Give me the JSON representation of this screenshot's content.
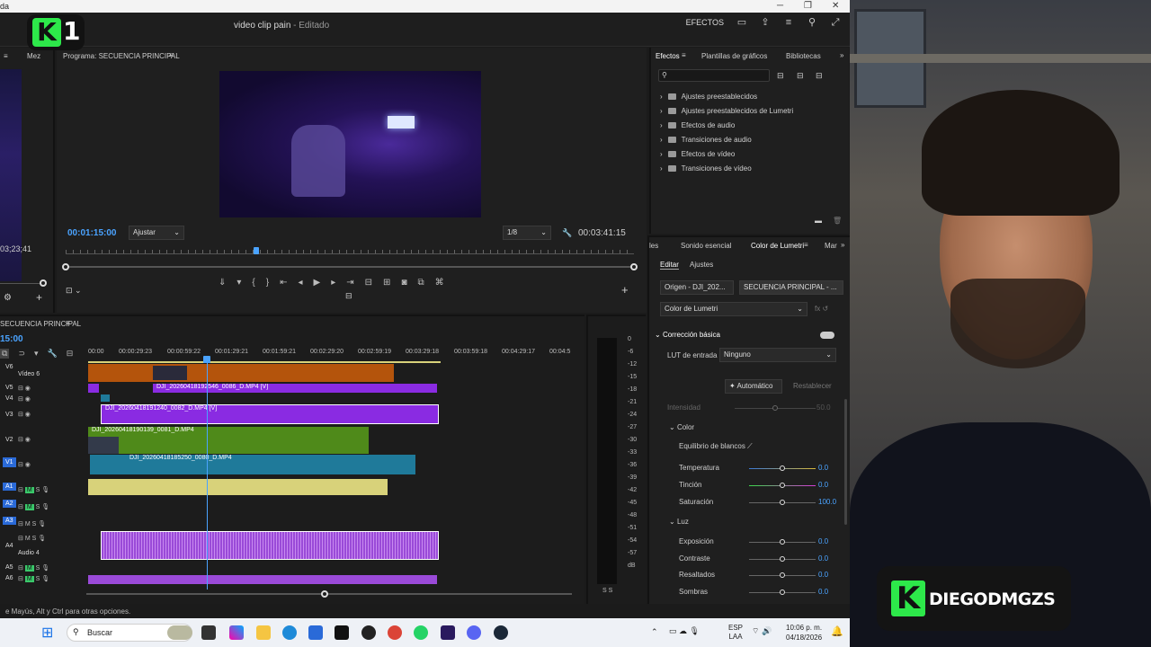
{
  "window": {
    "title_fragment": "da",
    "min": "─",
    "max": "❐",
    "close": "✕"
  },
  "header": {
    "project_name": "video clip pain",
    "project_sep": " - ",
    "project_state": "Editado",
    "effects_label": "EFECTOS"
  },
  "source": {
    "tab": "Mez",
    "timecode": "03;23;41"
  },
  "program": {
    "tab": "Programa: SECUENCIA PRINCIPAL",
    "timecode": "00:01:15:00",
    "fit": "Ajustar",
    "resolution": "1/8",
    "duration": "00:03:41:15"
  },
  "effects": {
    "tabs": [
      "Efectos",
      "Plantillas de gráficos",
      "Bibliotecas"
    ],
    "items": [
      "Ajustes preestablecidos",
      "Ajustes preestablecidos de Lumetri",
      "Efectos de audio",
      "Transiciones de audio",
      "Efectos de vídeo",
      "Transiciones de vídeo"
    ]
  },
  "lumetri": {
    "tabs": [
      "les",
      "Sonido esencial",
      "Color de Lumetri",
      "Mar"
    ],
    "subtabs": [
      "Editar",
      "Ajustes"
    ],
    "origin": "Origen - DJI_202...",
    "sequence": "SECUENCIA PRINCIPAL - ...",
    "effect": "Color de Lumetri",
    "section_basic": "Corrección básica",
    "lut_label": "LUT de entrada",
    "lut_value": "Ninguno",
    "auto": "Automático",
    "reset": "Restablecer",
    "intensity": "Intensidad",
    "intensity_value": "50.0",
    "color_section": "Color",
    "wb": "Equilibrio de blancos",
    "temp": "Temperatura",
    "temp_value": "0.0",
    "tint": "Tinción",
    "tint_value": "0.0",
    "sat": "Saturación",
    "sat_value": "100.0",
    "light_section": "Luz",
    "exposure": "Exposición",
    "exposure_value": "0.0",
    "contrast": "Contraste",
    "contrast_value": "0.0",
    "highlights": "Resaltados",
    "highlights_value": "0.0",
    "shadows": "Sombras",
    "shadows_value": "0.0"
  },
  "timeline": {
    "tab": "SECUENCIA PRINCIPAL",
    "timecode": "15:00",
    "ticks": [
      "00:00",
      "00:00:29:23",
      "00:00:59:22",
      "00:01:29:21",
      "00:01:59:21",
      "00:02:29:20",
      "00:02:59:19",
      "00:03:29:18",
      "00:03:59:18",
      "00:04:29:17",
      "00:04:5"
    ],
    "tracks": {
      "v6": "V6",
      "v6_name": "Vídeo 6",
      "v5": "V5",
      "v4": "V4",
      "v3": "V3",
      "v2": "V2",
      "v1": "V1",
      "a1": "A1",
      "a2": "A2",
      "a3": "A3",
      "a4": "A4",
      "a4_name": "Audio 4",
      "a5": "A5",
      "a6": "A6",
      "m": "M",
      "s": "S"
    },
    "clips": {
      "v5": "DJI_20260418192546_0086_D.MP4 [V]",
      "v3": "DJI_20260418191240_0082_D.MP4 [V]",
      "v2": "DJI_20260418190139_0081_D.MP4",
      "v1": "DJI_20260418185250_0080_D.MP4",
      "fx": "fx"
    }
  },
  "meter": {
    "db": [
      "0",
      "-6",
      "-12",
      "-15",
      "-18",
      "-21",
      "-24",
      "-27",
      "-30",
      "-33",
      "-36",
      "-39",
      "-42",
      "-45",
      "-48",
      "-51",
      "-54",
      "-57",
      "dB"
    ],
    "solo": "S  S"
  },
  "status_bar": "e Mayús, Alt y Ctrl para otras opciones.",
  "taskbar": {
    "search": "Buscar",
    "lang1": "ESP",
    "lang2": "LAA",
    "time": "10:06 p. m.",
    "date": "04/18/2026"
  },
  "overlay": {
    "logo_k": "K",
    "logo_1": "1",
    "badge_k": "K",
    "badge_name": "DIEGODMGZS"
  },
  "colors": {
    "accent": "#4aa3ff",
    "v_clip": "#8a2be2",
    "v1_clip": "#1f7a9a",
    "v2_clip": "#4f8a1a",
    "v6_clip": "#b4540c",
    "a1_clip": "#d8d27a",
    "a4_clip": "#9a4ad8"
  }
}
